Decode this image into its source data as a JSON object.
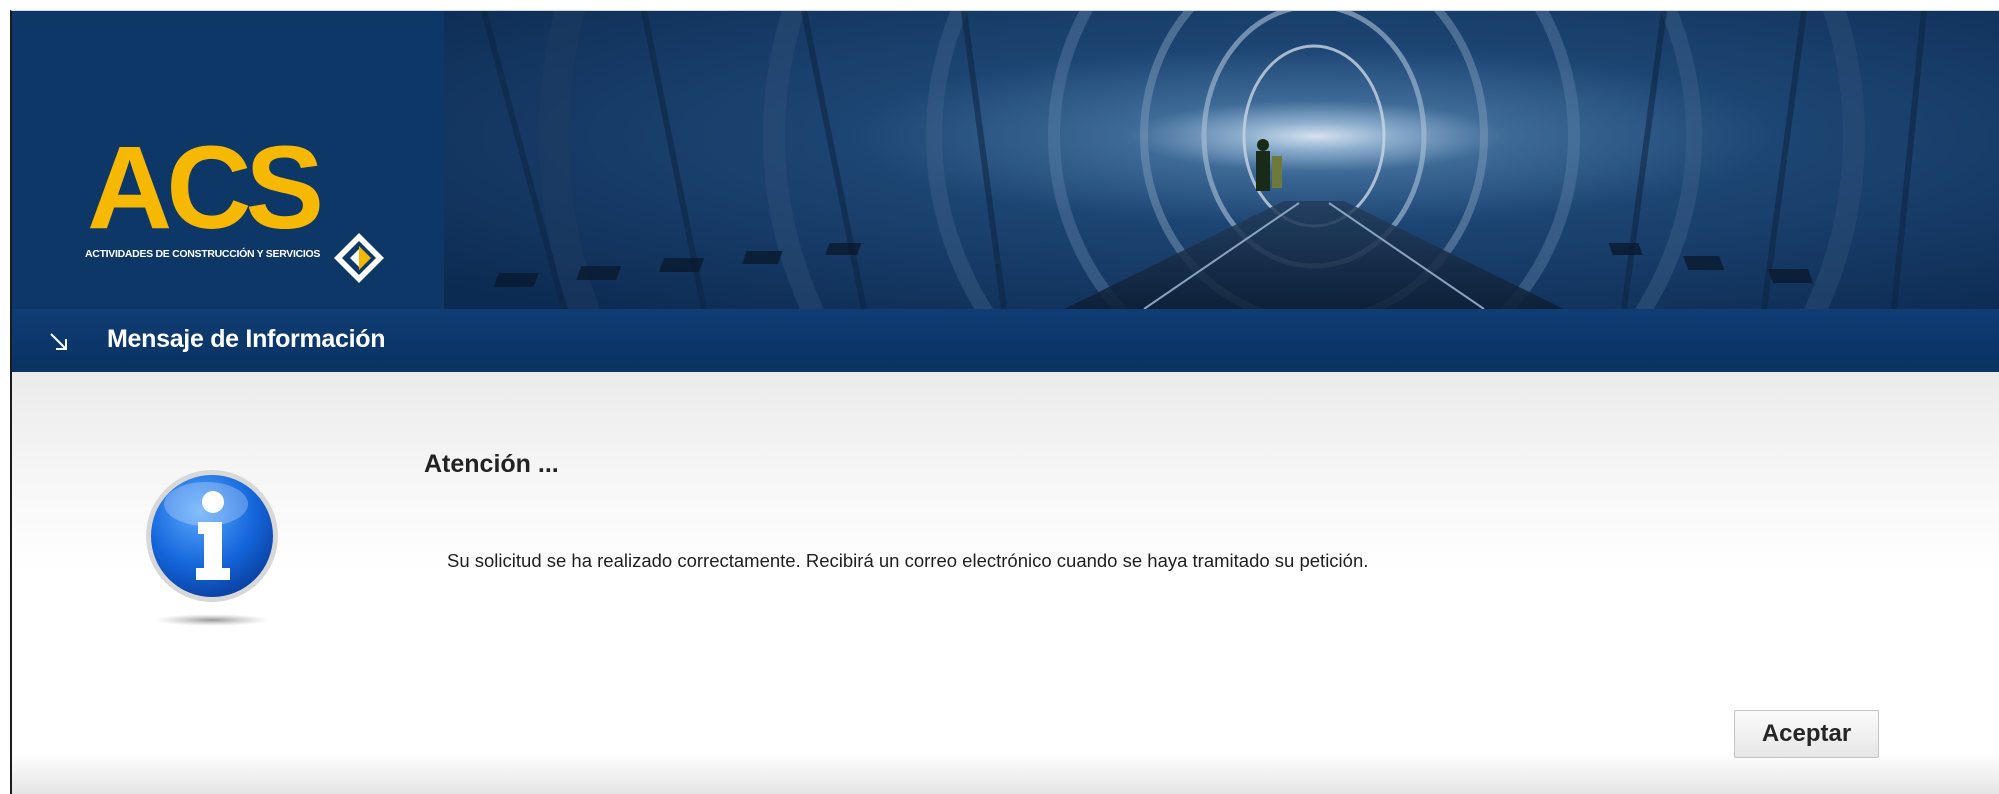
{
  "header": {
    "logo": {
      "wordmark": "ACS",
      "tagline": "ACTIVIDADES DE CONSTRUCCIÓN Y SERVICIOS",
      "wordmark_color": "#f6b800",
      "background_color": "#0d3767"
    }
  },
  "titlebar": {
    "icon": "arrow-down-right-icon",
    "title": "Mensaje de Información",
    "background_color": "#0b3466"
  },
  "message": {
    "icon": "info-icon",
    "heading": "Atención ...",
    "text": "Su solicitud se ha realizado correctamente. Recibirá un correo electrónico cuando se haya tramitado su petición.",
    "accept_label": "Aceptar"
  }
}
